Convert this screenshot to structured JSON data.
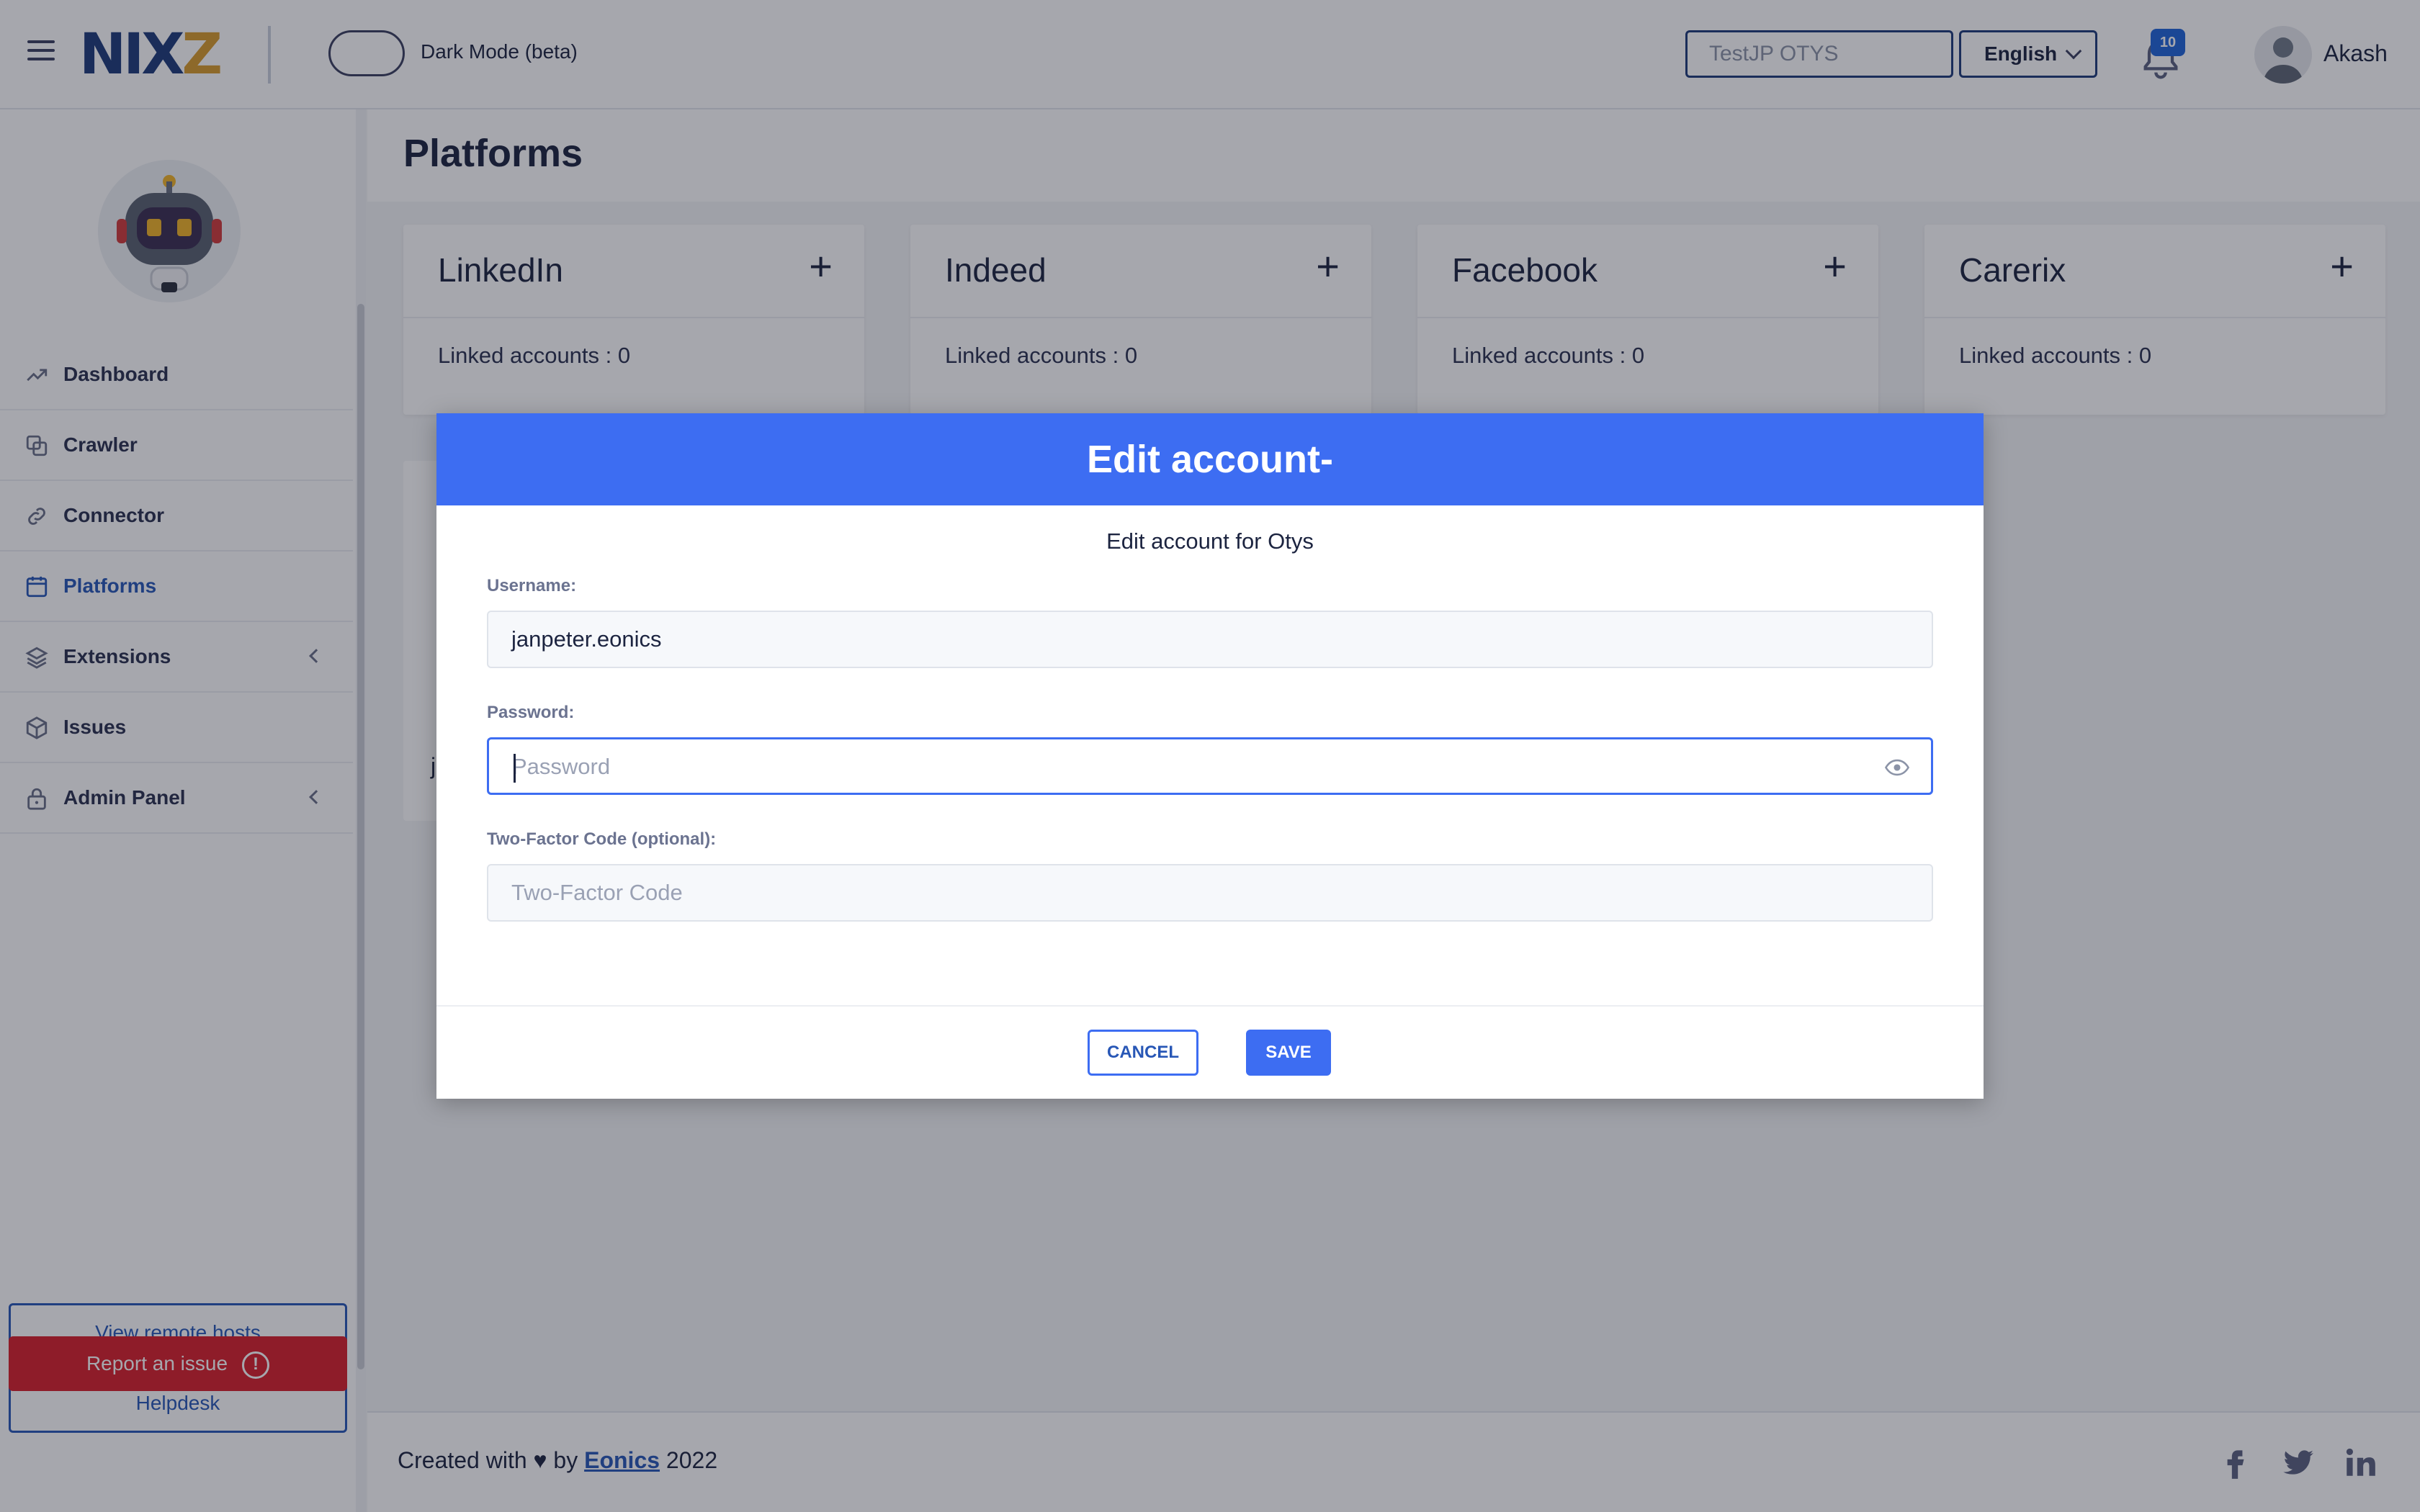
{
  "header": {
    "logo_part1": "NIX",
    "logo_part2": "Z",
    "dark_mode_label": "Dark Mode (beta)",
    "company_value": "TestJP OTYS",
    "language": "English",
    "notification_count": "10",
    "user_name": "Akash"
  },
  "sidebar": {
    "items": [
      {
        "label": "Dashboard",
        "icon": "trend-icon"
      },
      {
        "label": "Crawler",
        "icon": "copy-icon"
      },
      {
        "label": "Connector",
        "icon": "link-icon"
      },
      {
        "label": "Platforms",
        "icon": "calendar-icon"
      },
      {
        "label": "Extensions",
        "icon": "layers-icon"
      },
      {
        "label": "Issues",
        "icon": "box-icon"
      },
      {
        "label": "Admin Panel",
        "icon": "lock-icon"
      }
    ],
    "view_remote_hosts": "View remote hosts",
    "helpdesk": "Helpdesk",
    "report_issue": "Report an issue",
    "report_issue_mark": "!"
  },
  "main": {
    "title": "Platforms",
    "cards": [
      {
        "name": "LinkedIn",
        "linked": "Linked accounts : 0"
      },
      {
        "name": "Indeed",
        "linked": "Linked accounts : 0"
      },
      {
        "name": "Facebook",
        "linked": "Linked accounts : 0"
      },
      {
        "name": "Carerix",
        "linked": "Linked accounts : 0"
      }
    ],
    "card_plus": "+",
    "hidden_card_fragment": "j"
  },
  "footer": {
    "created_prefix": "Created with",
    "heart": "♥",
    "by": "by",
    "link": "Eonics",
    "year": "2022"
  },
  "modal": {
    "title": "Edit account-",
    "subtitle": "Edit account for Otys",
    "username_label": "Username:",
    "username_value": "janpeter.eonics",
    "password_label": "Password:",
    "password_placeholder": "Password",
    "twofactor_label": "Two-Factor Code (optional):",
    "twofactor_placeholder": "Two-Factor Code",
    "cancel": "CANCEL",
    "save": "SAVE"
  },
  "colors": {
    "accent": "#3d6df2",
    "link": "#2857b6",
    "danger": "#d8202b",
    "logo_blue": "#1e3a7a",
    "logo_gold": "#d79b2d"
  }
}
